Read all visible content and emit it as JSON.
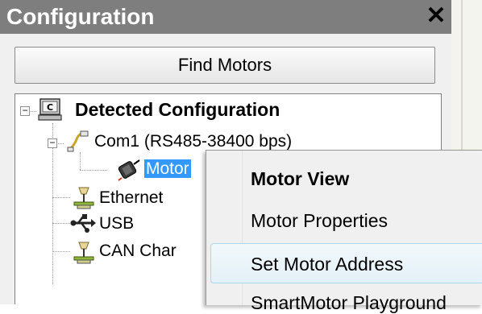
{
  "panel": {
    "title": "Configuration",
    "close_label": "✕",
    "find_button_label": "Find Motors"
  },
  "tree": {
    "root": {
      "label": "Detected Configuration",
      "expander": "−"
    },
    "com1": {
      "label": "Com1 (RS485-38400 bps)",
      "expander": "−"
    },
    "motor": {
      "label": "Motor"
    },
    "ethernet": {
      "label": "Ethernet"
    },
    "usb": {
      "label": "USB"
    },
    "can": {
      "label": "CAN Char"
    }
  },
  "context_menu": {
    "items": [
      {
        "label": "Motor View",
        "bold": true
      },
      {
        "label": "Motor Properties"
      },
      {
        "label": "Set Motor Address",
        "highlighted": true
      },
      {
        "label": "SmartMotor Playground"
      }
    ]
  },
  "colors": {
    "titlebar": "#7e7e7e",
    "selection": "#3399ff",
    "menu_highlight_border": "#a8d8eb"
  }
}
